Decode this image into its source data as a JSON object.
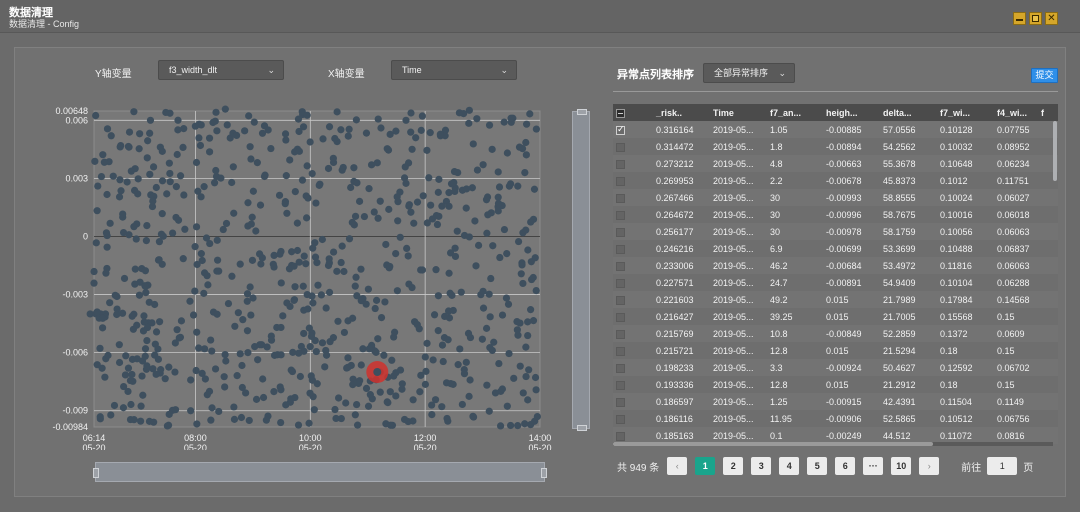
{
  "window": {
    "title": "数据清理",
    "subtitle": "数据清理 - Config",
    "buttons": {
      "minimize": "minimize-icon",
      "maximize": "maximize-icon",
      "close": "close-icon"
    }
  },
  "controls": {
    "y_axis_label": "Y轴变量",
    "y_axis_value": "f3_width_dlt",
    "x_axis_label": "X轴变量",
    "x_axis_value": "Time"
  },
  "chart_data": {
    "type": "scatter",
    "title": "",
    "xlabel": "",
    "ylabel": "",
    "y_tick_labels": [
      "0.00648",
      "0.006",
      "0.003",
      "0",
      "-0.003",
      "-0.006",
      "-0.009",
      "-0.00984"
    ],
    "y_ticks": [
      0.00648,
      0.006,
      0.003,
      0,
      -0.003,
      -0.006,
      -0.009,
      -0.00984
    ],
    "x_tick_labels": [
      [
        "06:14",
        "05-20"
      ],
      [
        "08:00",
        "05-20"
      ],
      [
        "10:00",
        "05-20"
      ],
      [
        "12:00",
        "05-20"
      ],
      [
        "14:00",
        "05-20"
      ]
    ],
    "xlim": [
      "2019-05-20 06:14",
      "2019-05-20 14:00"
    ],
    "ylim": [
      -0.00984,
      0.00648
    ],
    "grid": true,
    "point_color": "#3e4f5e",
    "highlight_color": "#d0312d",
    "highlight_point": {
      "x": "2019-05-20 11:10",
      "y": -0.007
    },
    "series": [
      {
        "x": [
          "06:10",
          "06:16",
          "06:21",
          "06:26",
          "06:32",
          "06:38",
          "06:44",
          "06:50",
          "06:57",
          "07:05",
          "07:13",
          "07:22",
          "07:30",
          "07:39",
          "07:47",
          "07:55",
          "08:04",
          "08:13",
          "08:22",
          "08:31",
          "08:40",
          "08:49",
          "08:58",
          "09:07",
          "09:16",
          "09:25",
          "09:34",
          "09:43",
          "09:52",
          "10:01",
          "10:10",
          "10:19",
          "10:28",
          "10:37",
          "10:46",
          "10:55",
          "11:04",
          "11:13",
          "11:22",
          "11:31",
          "11:40",
          "11:49",
          "11:58",
          "12:07",
          "12:16",
          "12:25",
          "12:34",
          "12:43",
          "12:52",
          "13:01",
          "13:10",
          "13:19",
          "13:28",
          "13:37",
          "13:46",
          "13:55"
        ],
        "y": [
          -0.004,
          -0.004,
          -0.004,
          -0.004,
          0.0052,
          -0.0031,
          0.001,
          -0.0068,
          0.0035,
          -0.0082,
          0.006,
          -0.0012,
          0.0022,
          -0.0055,
          0.0046,
          -0.009,
          0.0058,
          -0.0025,
          0.0031,
          -0.0061,
          0.0012,
          -0.0078,
          0.004,
          -0.0009,
          0.0055,
          -0.0047,
          0.0018,
          -0.0033,
          0.0063,
          -0.0072,
          0.0027,
          -0.0015,
          0.0049,
          -0.0086,
          0.0006,
          -0.0058,
          0.0037,
          -0.007,
          0.0014,
          -0.0028,
          0.006,
          -0.0044,
          0.0021,
          -0.0092,
          0.0052,
          -0.0019,
          0.0033,
          -0.0065,
          0.0008,
          -0.0037,
          0.0045,
          -0.008,
          0.0026,
          -0.0051,
          0.0058,
          -0.0011
        ]
      }
    ]
  },
  "list": {
    "title": "异常点列表排序",
    "sort_value": "全部异常排序",
    "submit_label": "提交",
    "columns": [
      "_risk..",
      "Time",
      "f7_an...",
      "heigh...",
      "delta...",
      "f7_wi...",
      "f4_wi...",
      "f"
    ],
    "rows": [
      {
        "checked": true,
        "cells": [
          "0.316164",
          "2019-05...",
          "1.05",
          "-0.00885",
          "57.0556",
          "0.10128",
          "0.07755"
        ]
      },
      {
        "checked": false,
        "cells": [
          "0.314472",
          "2019-05...",
          "1.8",
          "-0.00894",
          "54.2562",
          "0.10032",
          "0.08952"
        ]
      },
      {
        "checked": false,
        "cells": [
          "0.273212",
          "2019-05...",
          "4.8",
          "-0.00663",
          "55.3678",
          "0.10648",
          "0.06234"
        ]
      },
      {
        "checked": false,
        "cells": [
          "0.269953",
          "2019-05...",
          "2.2",
          "-0.00678",
          "45.8373",
          "0.1012",
          "0.11751"
        ]
      },
      {
        "checked": false,
        "cells": [
          "0.267466",
          "2019-05...",
          "30",
          "-0.00993",
          "58.8555",
          "0.10024",
          "0.06027"
        ]
      },
      {
        "checked": false,
        "cells": [
          "0.264672",
          "2019-05...",
          "30",
          "-0.00996",
          "58.7675",
          "0.10016",
          "0.06018"
        ]
      },
      {
        "checked": false,
        "cells": [
          "0.256177",
          "2019-05...",
          "30",
          "-0.00978",
          "58.1759",
          "0.10056",
          "0.06063"
        ]
      },
      {
        "checked": false,
        "cells": [
          "0.246216",
          "2019-05...",
          "6.9",
          "-0.00699",
          "53.3699",
          "0.10488",
          "0.06837"
        ]
      },
      {
        "checked": false,
        "cells": [
          "0.233006",
          "2019-05...",
          "46.2",
          "-0.00684",
          "53.4972",
          "0.11816",
          "0.06063"
        ]
      },
      {
        "checked": false,
        "cells": [
          "0.227571",
          "2019-05...",
          "24.7",
          "-0.00891",
          "54.9409",
          "0.10104",
          "0.06288"
        ]
      },
      {
        "checked": false,
        "cells": [
          "0.221603",
          "2019-05...",
          "49.2",
          "0.015",
          "21.7989",
          "0.17984",
          "0.14568"
        ]
      },
      {
        "checked": false,
        "cells": [
          "0.216427",
          "2019-05...",
          "39.25",
          "0.015",
          "21.7005",
          "0.15568",
          "0.15"
        ]
      },
      {
        "checked": false,
        "cells": [
          "0.215769",
          "2019-05...",
          "10.8",
          "-0.00849",
          "52.2859",
          "0.1372",
          "0.0609"
        ]
      },
      {
        "checked": false,
        "cells": [
          "0.215721",
          "2019-05...",
          "12.8",
          "0.015",
          "21.5294",
          "0.18",
          "0.15"
        ]
      },
      {
        "checked": false,
        "cells": [
          "0.198233",
          "2019-05...",
          "3.3",
          "-0.00924",
          "50.4627",
          "0.12592",
          "0.06702"
        ]
      },
      {
        "checked": false,
        "cells": [
          "0.193336",
          "2019-05...",
          "12.8",
          "0.015",
          "21.2912",
          "0.18",
          "0.15"
        ]
      },
      {
        "checked": false,
        "cells": [
          "0.186597",
          "2019-05...",
          "1.25",
          "-0.00915",
          "42.4391",
          "0.11504",
          "0.1149"
        ]
      },
      {
        "checked": false,
        "cells": [
          "0.186116",
          "2019-05...",
          "11.95",
          "-0.00906",
          "52.5865",
          "0.10512",
          "0.06756"
        ]
      },
      {
        "checked": false,
        "cells": [
          "0.185163",
          "2019-05...",
          "0.1",
          "-0.00249",
          "44.512",
          "0.11072",
          "0.0816"
        ]
      }
    ]
  },
  "pager": {
    "total": "共 949 条",
    "prev": "‹",
    "pages": [
      "1",
      "2",
      "3",
      "4",
      "5",
      "6",
      "···",
      "10"
    ],
    "active": "1",
    "next": "›",
    "goto_label": "前往",
    "goto_value": "1",
    "goto_suffix": "页"
  }
}
